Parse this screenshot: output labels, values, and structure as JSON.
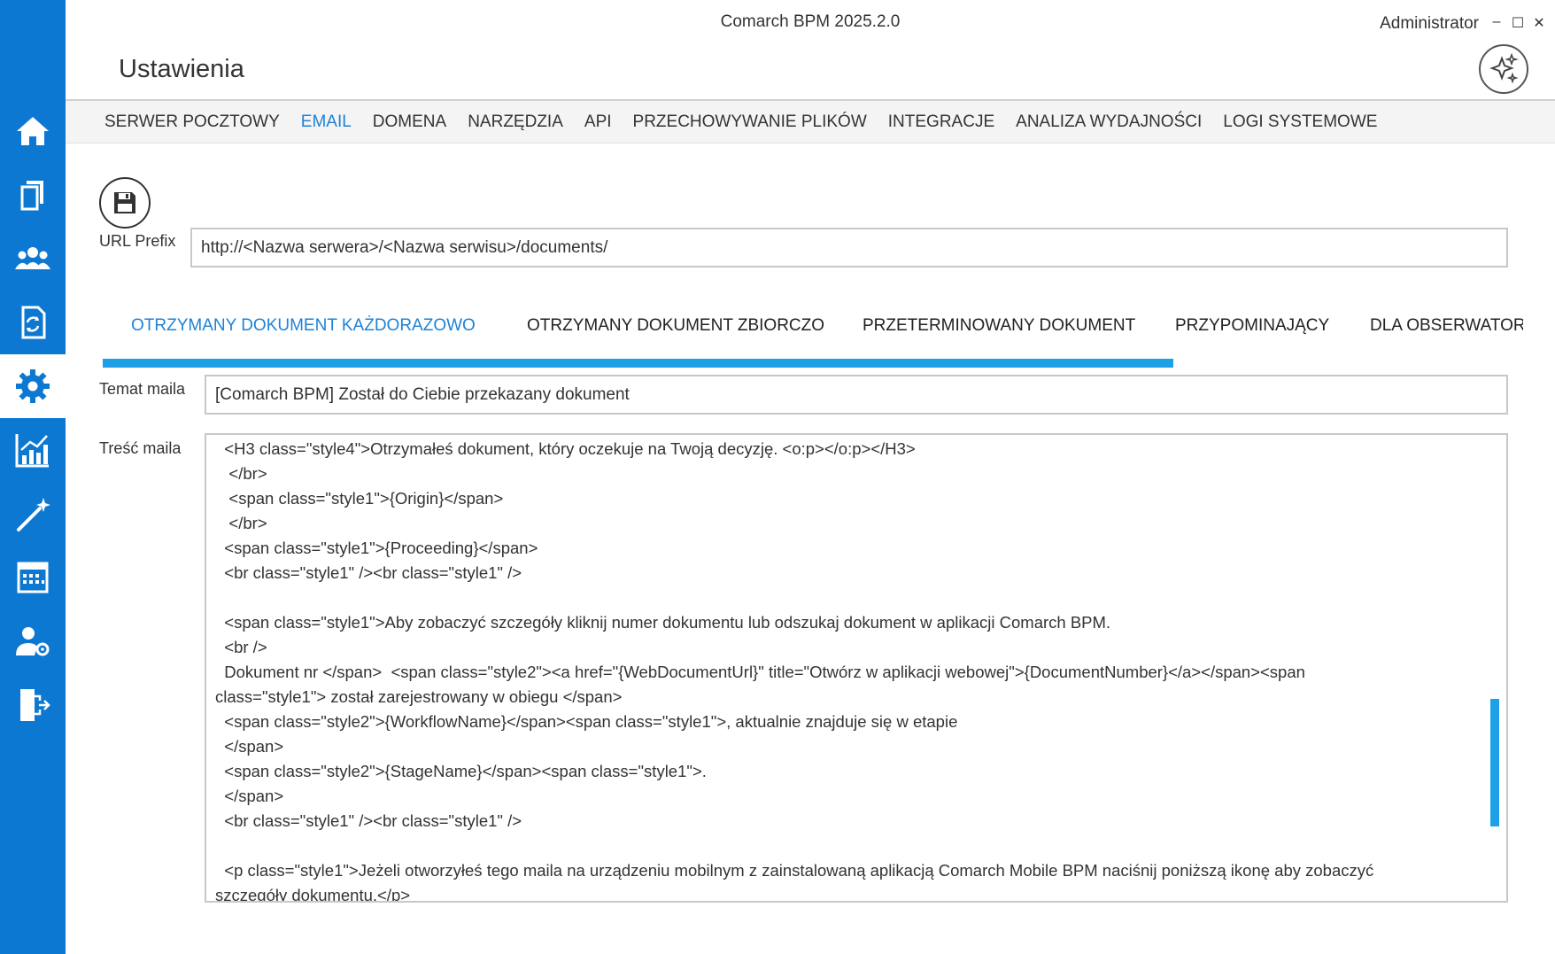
{
  "app": {
    "title": "Comarch BPM 2025.2.0",
    "user": "Administrator",
    "page_title": "Ustawienia",
    "window_controls": {
      "minimize": "–",
      "maximize": "☐",
      "close": "✕"
    }
  },
  "sidebar": {
    "items": [
      {
        "icon": "home-icon"
      },
      {
        "icon": "documents-icon"
      },
      {
        "icon": "users-icon"
      },
      {
        "icon": "sync-document-icon"
      },
      {
        "icon": "gear-icon",
        "active": true
      },
      {
        "icon": "chart-icon"
      },
      {
        "icon": "magic-wand-icon"
      },
      {
        "icon": "calendar-icon"
      },
      {
        "icon": "user-settings-icon"
      },
      {
        "icon": "logout-icon"
      }
    ],
    "colors": {
      "background": "#0c78d2",
      "active": "#ffffff"
    }
  },
  "menu": {
    "items": [
      {
        "label": "SERWER POCZTOWY"
      },
      {
        "label": "EMAIL",
        "active": true
      },
      {
        "label": "DOMENA"
      },
      {
        "label": "NARZĘDZIA"
      },
      {
        "label": "API"
      },
      {
        "label": "PRZECHOWYWANIE PLIKÓW"
      },
      {
        "label": "INTEGRACJE"
      },
      {
        "label": "ANALIZA WYDAJNOŚCI"
      },
      {
        "label": "LOGI SYSTEMOWE"
      }
    ],
    "active_color": "#1e82d6"
  },
  "form": {
    "url_prefix_label": "URL Prefix",
    "url_prefix_value": "http://<Nazwa serwera>/<Nazwa serwisu>/documents/",
    "subject_label": "Temat maila",
    "subject_value": "[Comarch BPM] Został do Ciebie przekazany dokument",
    "body_label": "Treść maila",
    "body_lines": [
      "  <H3 class=\"style4\">Otrzymałeś dokument, który oczekuje na Twoją decyzję. <o:p></o:p></H3>",
      "   </br>",
      "   <span class=\"style1\">{Origin}</span>",
      "   </br>",
      "  <span class=\"style1\">{Proceeding}</span>",
      "  <br class=\"style1\" /><br class=\"style1\" />",
      "",
      "  <span class=\"style1\">Aby zobaczyć szczegóły kliknij numer dokumentu lub odszukaj dokument w aplikacji Comarch BPM.",
      "  <br />",
      "  Dokument nr </span>  <span class=\"style2\"><a href=\"{WebDocumentUrl}\" title=\"Otwórz w aplikacji webowej\">{DocumentNumber}</a></span><span",
      "class=\"style1\"> został zarejestrowany w obiegu </span>",
      "  <span class=\"style2\">{WorkflowName}</span><span class=\"style1\">, aktualnie znajduje się w etapie",
      "  </span>",
      "  <span class=\"style2\">{StageName}</span><span class=\"style1\">.",
      "  </span>",
      "  <br class=\"style1\" /><br class=\"style1\" />",
      "",
      "  <p class=\"style1\">Jeżeli otworzyłeś tego maila na urządzeniu mobilnym z zainstalowaną aplikacją Comarch Mobile BPM naciśnij poniższą ikonę aby zobaczyć",
      "szczegóły dokumentu.</p>"
    ]
  },
  "subtabs": {
    "items": [
      {
        "label": "OTRZYMANY DOKUMENT KAŻDORAZOWO",
        "active": true
      },
      {
        "label": "OTRZYMANY DOKUMENT ZBIORCZO"
      },
      {
        "label": "PRZETERMINOWANY DOKUMENT"
      },
      {
        "label": "PRZYPOMINAJĄCY"
      },
      {
        "label": "DLA OBSERWATORA"
      }
    ],
    "indicator_color": "#1ea0e6"
  },
  "icons": {
    "save": "save-icon",
    "assistant": "sparkles-icon"
  }
}
